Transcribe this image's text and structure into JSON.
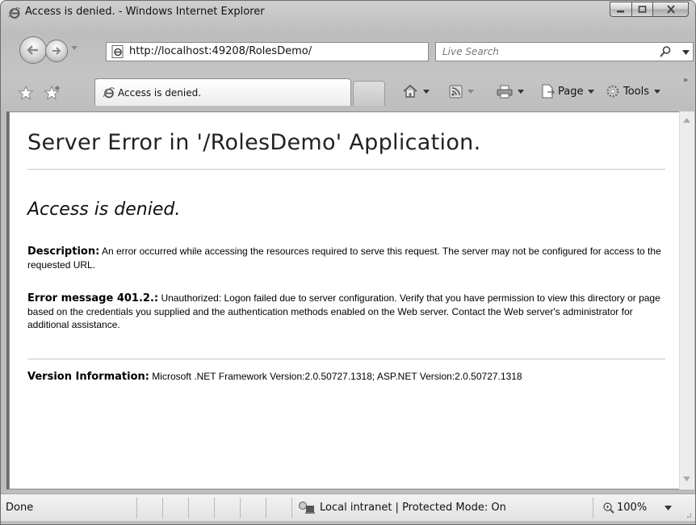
{
  "window": {
    "title": "Access is denied. - Windows Internet Explorer"
  },
  "address_bar": {
    "url": "http://localhost:49208/RolesDemo/"
  },
  "search": {
    "placeholder": "Live Search"
  },
  "tab": {
    "label": "Access is denied."
  },
  "commands": {
    "page_label": "Page",
    "tools_label": "Tools",
    "overflow": "»"
  },
  "page": {
    "title": "Server Error in '/RolesDemo' Application.",
    "subtitle": "Access is denied.",
    "description_label": "Description:",
    "description_text": "An error occurred while accessing the resources required to serve this request. The server may not be configured for access to the requested URL.",
    "error_label": "Error message 401.2.:",
    "error_text": "Unauthorized: Logon failed due to server configuration.  Verify that you have permission to view this directory or page based on the credentials you supplied and the authentication methods enabled on the Web server.  Contact the Web server's administrator for additional assistance.",
    "version_label": "Version Information:",
    "version_text": "Microsoft .NET Framework Version:2.0.50727.1318; ASP.NET Version:2.0.50727.1318"
  },
  "status": {
    "text": "Done",
    "zone": "Local intranet | Protected Mode: On",
    "zoom": "100%"
  },
  "icons": {
    "browser": "ie-icon",
    "back": "back-arrow-icon",
    "forward": "forward-arrow-icon",
    "refresh": "refresh-icon",
    "stop": "stop-icon",
    "search": "search-icon",
    "favorites": "favorites-star-icon",
    "add_favorite": "add-favorite-icon",
    "home": "home-icon",
    "feeds": "feeds-icon",
    "print": "print-icon",
    "page": "page-icon",
    "tools": "gear-icon",
    "zone": "local-intranet-icon",
    "zoom": "zoom-icon"
  }
}
